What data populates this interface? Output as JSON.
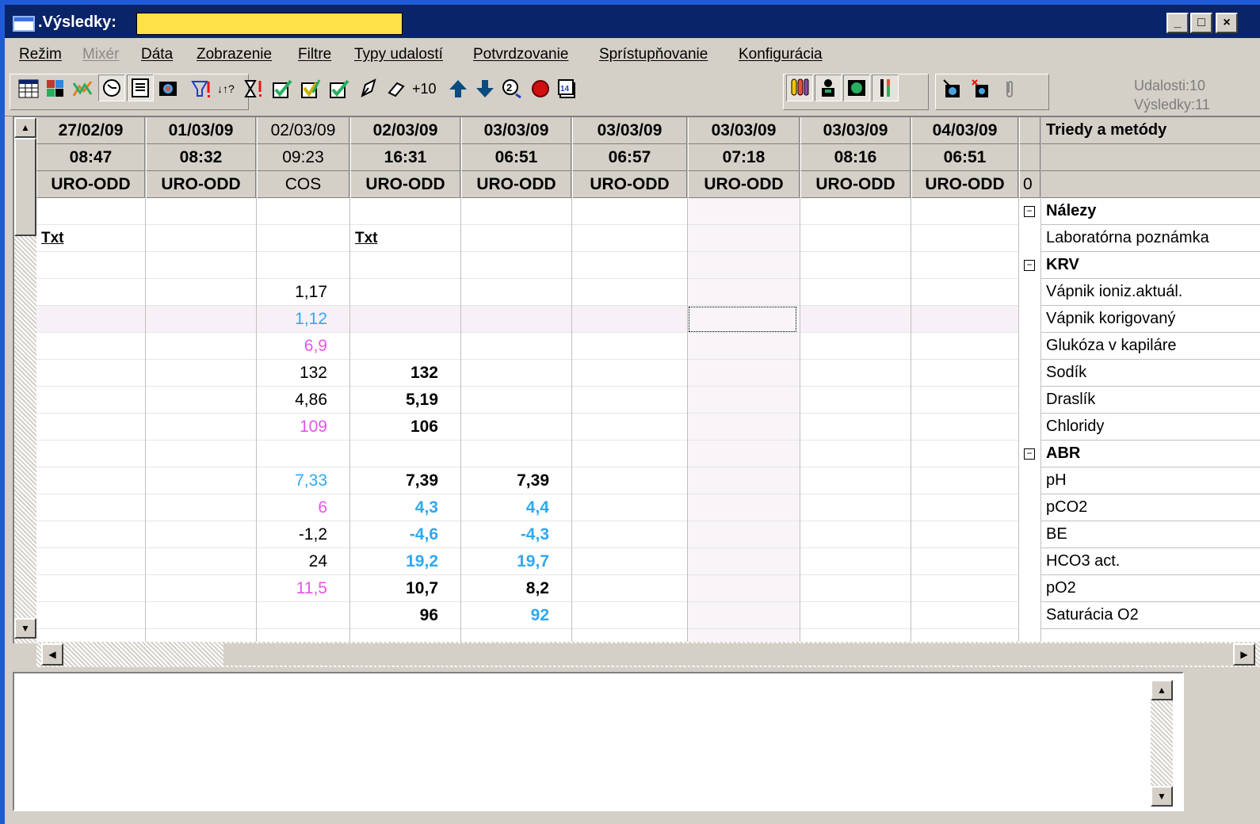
{
  "window": {
    "title": ".Výsledky:",
    "minimize": "_",
    "maximize": "□",
    "close": "×"
  },
  "menu": [
    {
      "label": "Režim",
      "enabled": true
    },
    {
      "label": "Mixér",
      "enabled": false
    },
    {
      "label": "Dáta",
      "enabled": true
    },
    {
      "label": "Zobrazenie",
      "enabled": true
    },
    {
      "label": "Filtre",
      "enabled": true
    },
    {
      "label": "Typy udalostí",
      "enabled": true
    },
    {
      "label": "Potvrdzovanie",
      "enabled": true
    },
    {
      "label": "Sprístupňovanie",
      "enabled": true
    },
    {
      "label": "Konfigurácia",
      "enabled": true
    }
  ],
  "toolbar": {
    "plus10_label": "+10",
    "counts": {
      "events": "Udalosti:10",
      "results": "Výsledky:11"
    }
  },
  "columns": [
    {
      "date": "27/02/09",
      "time": "08:47",
      "dept": "URO-ODD",
      "bold": true
    },
    {
      "date": "01/03/09",
      "time": "08:32",
      "dept": "URO-ODD",
      "bold": true
    },
    {
      "date": "02/03/09",
      "time": "09:23",
      "dept": "COS",
      "bold": false
    },
    {
      "date": "02/03/09",
      "time": "16:31",
      "dept": "URO-ODD",
      "bold": true
    },
    {
      "date": "03/03/09",
      "time": "06:51",
      "dept": "URO-ODD",
      "bold": true
    },
    {
      "date": "03/03/09",
      "time": "06:57",
      "dept": "URO-ODD",
      "bold": true
    },
    {
      "date": "03/03/09",
      "time": "07:18",
      "dept": "URO-ODD",
      "bold": true
    },
    {
      "date": "03/03/09",
      "time": "08:16",
      "dept": "URO-ODD",
      "bold": true
    },
    {
      "date": "04/03/09",
      "time": "06:51",
      "dept": "URO-ODD",
      "bold": true
    }
  ],
  "ref_header": "0",
  "names_header": "Triedy a metódy",
  "rows": [
    {
      "name": "Nálezy",
      "group": true
    },
    {
      "name": "Laboratórna poznámka",
      "group": false
    },
    {
      "name": "KRV",
      "group": true
    },
    {
      "name": "Vápnik ioniz.aktuál.",
      "group": false
    },
    {
      "name": "Vápnik korigovaný",
      "group": false
    },
    {
      "name": "Glukóza v kapiláre",
      "group": false
    },
    {
      "name": "Sodík",
      "group": false
    },
    {
      "name": "Draslík",
      "group": false
    },
    {
      "name": "Chloridy",
      "group": false
    },
    {
      "name": "ABR",
      "group": true
    },
    {
      "name": "pH",
      "group": false
    },
    {
      "name": "pCO2",
      "group": false
    },
    {
      "name": "BE",
      "group": false
    },
    {
      "name": "HCO3 act.",
      "group": false
    },
    {
      "name": "pO2",
      "group": false
    },
    {
      "name": "Saturácia O2",
      "group": false
    }
  ],
  "cells": [
    {
      "row": 1,
      "col": 0,
      "text": "Txt",
      "color": "txt"
    },
    {
      "row": 1,
      "col": 3,
      "text": "Txt",
      "color": "txt"
    },
    {
      "row": 3,
      "col": 2,
      "text": "1,17",
      "color": "black"
    },
    {
      "row": 4,
      "col": 2,
      "text": "1,12",
      "color": "blue"
    },
    {
      "row": 5,
      "col": 2,
      "text": "6,9",
      "color": "magenta"
    },
    {
      "row": 6,
      "col": 2,
      "text": "132",
      "color": "black"
    },
    {
      "row": 6,
      "col": 3,
      "text": "132",
      "color": "black"
    },
    {
      "row": 7,
      "col": 2,
      "text": "4,86",
      "color": "black"
    },
    {
      "row": 7,
      "col": 3,
      "text": "5,19",
      "color": "black"
    },
    {
      "row": 8,
      "col": 2,
      "text": "109",
      "color": "magenta"
    },
    {
      "row": 8,
      "col": 3,
      "text": "106",
      "color": "black"
    },
    {
      "row": 10,
      "col": 2,
      "text": "7,33",
      "color": "blue"
    },
    {
      "row": 10,
      "col": 3,
      "text": "7,39",
      "color": "black"
    },
    {
      "row": 10,
      "col": 4,
      "text": "7,39",
      "color": "black"
    },
    {
      "row": 11,
      "col": 2,
      "text": "6",
      "color": "magenta"
    },
    {
      "row": 11,
      "col": 3,
      "text": "4,3",
      "color": "blue"
    },
    {
      "row": 11,
      "col": 4,
      "text": "4,4",
      "color": "blue"
    },
    {
      "row": 12,
      "col": 2,
      "text": "-1,2",
      "color": "black"
    },
    {
      "row": 12,
      "col": 3,
      "text": "-4,6",
      "color": "blue"
    },
    {
      "row": 12,
      "col": 4,
      "text": "-4,3",
      "color": "blue"
    },
    {
      "row": 13,
      "col": 2,
      "text": "24",
      "color": "black"
    },
    {
      "row": 13,
      "col": 3,
      "text": "19,2",
      "color": "blue"
    },
    {
      "row": 13,
      "col": 4,
      "text": "19,7",
      "color": "blue"
    },
    {
      "row": 14,
      "col": 2,
      "text": "11,5",
      "color": "magenta"
    },
    {
      "row": 14,
      "col": 3,
      "text": "10,7",
      "color": "black"
    },
    {
      "row": 14,
      "col": 4,
      "text": "8,2",
      "color": "black"
    },
    {
      "row": 15,
      "col": 3,
      "text": "96",
      "color": "black"
    },
    {
      "row": 15,
      "col": 4,
      "text": "92",
      "color": "blue"
    }
  ],
  "colors": {
    "black": "#000000",
    "blue": "#2fa8f0",
    "magenta": "#e455e8",
    "title_field": "#ffe14a"
  }
}
